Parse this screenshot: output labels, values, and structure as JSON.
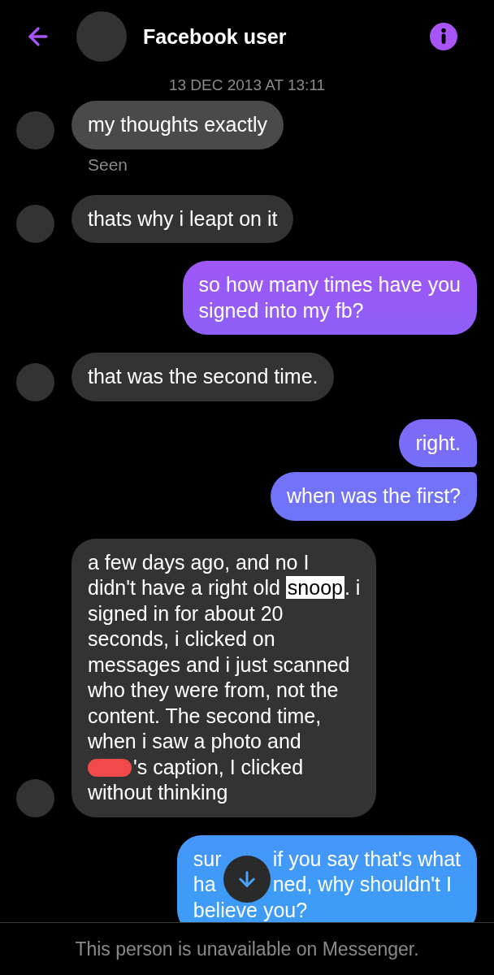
{
  "header": {
    "title": "Facebook user"
  },
  "timestamp": "13 DEC 2013 AT 13:11",
  "messages": [
    {
      "kind": "received",
      "selected": true,
      "status": "Seen",
      "lines": [
        "my thoughts exactly"
      ]
    },
    {
      "kind": "received",
      "selected": false,
      "lines": [
        "thats why i leapt on it"
      ]
    },
    {
      "kind": "sent",
      "selected": false,
      "lines": [
        "so how many times have you",
        "signed into my fb?"
      ]
    },
    {
      "kind": "received",
      "selected": false,
      "lines": [
        "that was the second time."
      ]
    },
    {
      "kind": "sent",
      "selected": false,
      "lines": [
        "right."
      ]
    },
    {
      "kind": "sent",
      "selected": false,
      "lines": [
        "when was the first?"
      ]
    },
    {
      "kind": "received",
      "selected": false,
      "lines": [
        "a few days ago, and no I",
        [
          {
            "text": "didn't have a right old ",
            "highlighted": false
          },
          {
            "text": "snoop",
            "highlighted": true
          },
          {
            "text": ". i",
            "highlighted": false
          }
        ],
        "signed in for about 20",
        "seconds, i clicked on",
        "messages and i just scanned",
        "who they were from, not the",
        "content. The second time,",
        "when i saw a photo and",
        [
          {
            "kind": "redacted"
          },
          {
            "text": "'s caption, I clicked"
          }
        ],
        "without thinking"
      ]
    },
    {
      "kind": "sent",
      "selected": false,
      "lines": [
        [
          {
            "text": "sur"
          },
          {
            "kind": "covered"
          },
          {
            "text": "if you say that's what"
          }
        ],
        [
          {
            "text": "ha"
          },
          {
            "kind": "covered"
          },
          {
            "text": "ned, why shouldn't I"
          }
        ],
        "believe you?"
      ]
    }
  ],
  "footer": {
    "notice": "This person is unavailable on Messenger."
  }
}
